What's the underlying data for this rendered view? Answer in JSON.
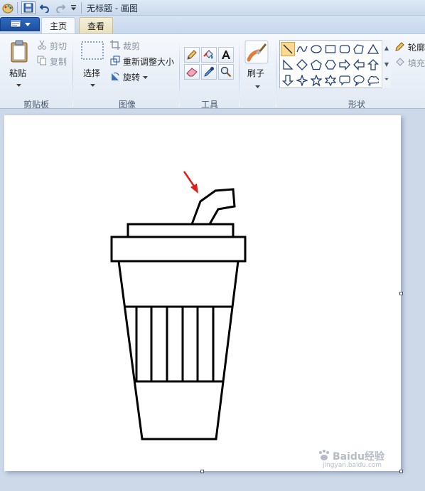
{
  "window": {
    "title": "无标题 - 画图"
  },
  "quick_access": {
    "app_icon": "paint-palette-icon",
    "save_icon": "save-icon",
    "undo_icon": "undo-icon",
    "redo_icon": "redo-icon",
    "customize_icon": "dropdown-arrow-icon"
  },
  "tabs": {
    "file_menu_icon": "file-menu-icon",
    "home": "主页",
    "view": "查看"
  },
  "clipboard": {
    "paste": "粘贴",
    "cut": "剪切",
    "copy": "复制",
    "group_label": "剪贴板"
  },
  "image": {
    "select": "选择",
    "crop": "裁剪",
    "resize": "重新调整大小",
    "rotate": "旋转",
    "group_label": "图像"
  },
  "tools": {
    "items": [
      "pencil-icon",
      "fill-bucket-icon",
      "text-icon",
      "eraser-icon",
      "color-picker-icon",
      "magnifier-icon"
    ],
    "group_label": "工具"
  },
  "brushes": {
    "label": "刷子"
  },
  "shapes": {
    "items": [
      "line",
      "curve",
      "oval",
      "rectangle",
      "rounded-rectangle",
      "polygon",
      "triangle",
      "right-triangle",
      "diamond",
      "pentagon",
      "hexagon",
      "right-arrow",
      "left-arrow",
      "up-arrow",
      "down-arrow",
      "four-point-star",
      "five-point-star",
      "six-point-star",
      "rounded-callout",
      "oval-callout",
      "cloud-callout"
    ],
    "selected": "line",
    "outline": "轮廓",
    "fill": "填充",
    "group_label": "形状"
  },
  "colors": {
    "ribbon_bg": "#e7eef7",
    "accent_blue": "#1d4f9e",
    "arrow_red": "#e21b1b",
    "drawing_stroke": "#000000"
  },
  "watermark": {
    "text": "Baidu经验",
    "url_text": "jingyan.baidu.com"
  }
}
